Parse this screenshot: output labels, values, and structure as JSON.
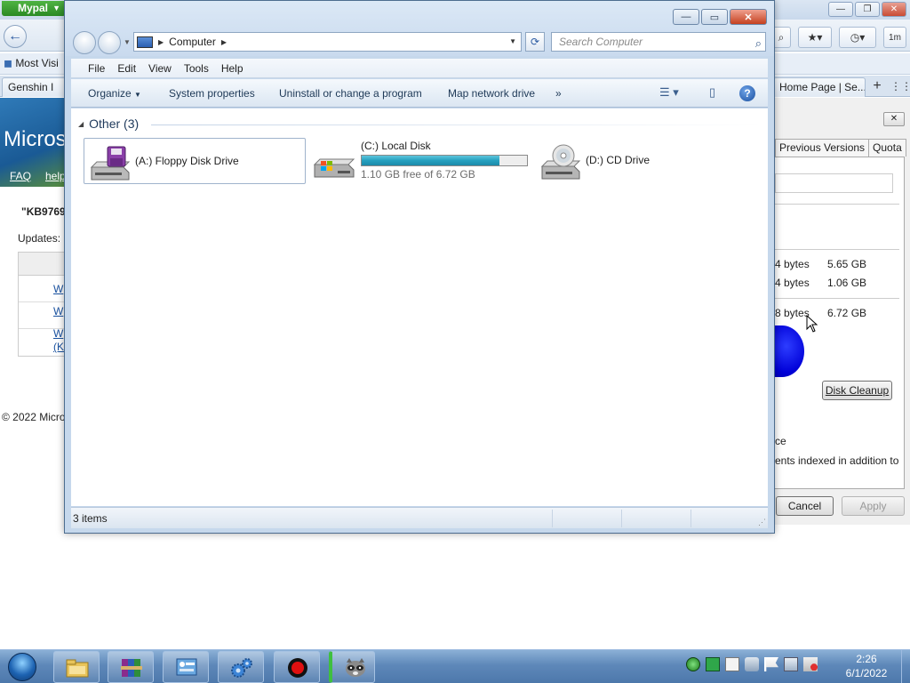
{
  "bg_browser": {
    "menu_button": "Mypal",
    "bookmarks_label": "Most Visi",
    "tab1_label": "Genshin I",
    "tab2_label": "Home Page | Se...",
    "toolbar_text": "1m",
    "page": {
      "banner_title": "Micros",
      "faq_link": "FAQ",
      "help_link": "help",
      "kb_text": "\"KB9769",
      "updates_text": "Updates: 1",
      "row_links": [
        "W",
        "W",
        "W",
        "(K"
      ],
      "copyright": "© 2022 Micro"
    }
  },
  "properties_dialog": {
    "tabs": [
      "Previous Versions",
      "Quota"
    ],
    "rows": [
      {
        "bytes": "4 bytes",
        "size": "5.65 GB"
      },
      {
        "bytes": "4 bytes",
        "size": "1.06 GB"
      },
      {
        "bytes": "8 bytes",
        "size": "6.72 GB"
      }
    ],
    "disk_cleanup_label": "Disk Cleanup",
    "compress_text": "ce",
    "index_text": "ents indexed in addition to",
    "cancel_label": "Cancel",
    "apply_label": "Apply",
    "pie_color": "#0000d8"
  },
  "explorer": {
    "address": {
      "location": "Computer"
    },
    "search_placeholder": "Search Computer",
    "menu": [
      "File",
      "Edit",
      "View",
      "Tools",
      "Help"
    ],
    "commands": {
      "organize": "Organize",
      "system_properties": "System properties",
      "uninstall": "Uninstall or change a program",
      "map_drive": "Map network drive",
      "more": "»"
    },
    "group_label": "Other (3)",
    "drives": [
      {
        "name": "(A:) Floppy Disk Drive",
        "icon": "floppy-drive-icon"
      },
      {
        "name": "(C:) Local Disk",
        "free": "1.10 GB free of 6.72 GB",
        "used_fraction": 0.836,
        "icon": "hard-disk-icon"
      },
      {
        "name": "(D:) CD Drive",
        "icon": "cd-drive-icon"
      }
    ],
    "status_text": "3 items",
    "bar_color": "#26a0bf"
  },
  "taskbar": {
    "clock_time": "2:26",
    "clock_date": "6/1/2022",
    "apps": [
      "explorer-icon",
      "winrar-icon",
      "control-panel-icon",
      "settings-gears-icon",
      "recorder-icon",
      "raccoon-app-icon"
    ]
  }
}
